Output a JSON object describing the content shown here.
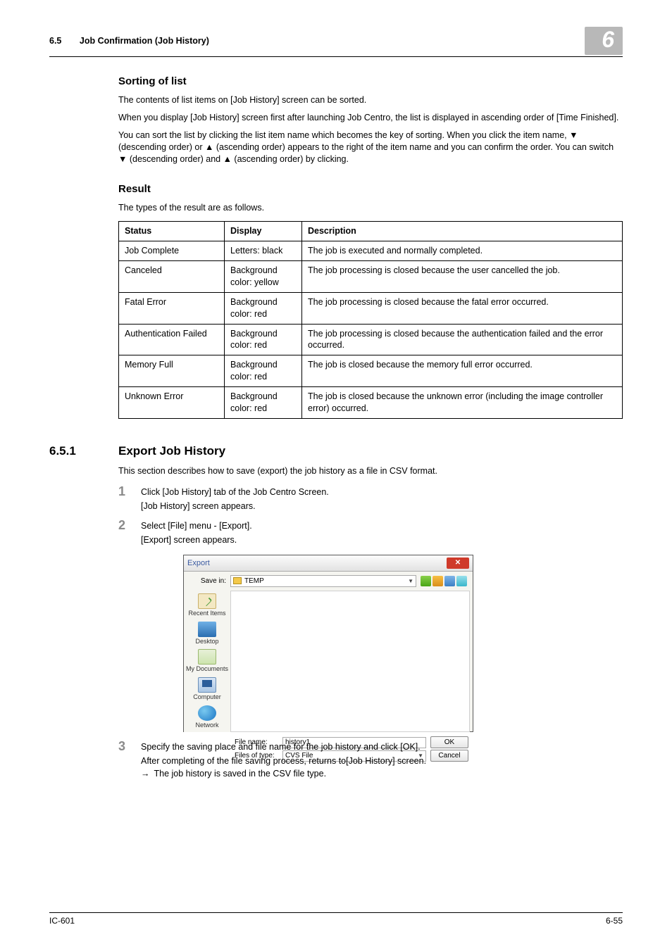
{
  "header": {
    "section_number": "6.5",
    "section_title": "Job Confirmation (Job History)",
    "chapter_badge": "6"
  },
  "sorting": {
    "heading": "Sorting of list",
    "p1": "The contents of list items on [Job History] screen can be sorted.",
    "p2": "When you display [Job History] screen first after launching Job Centro, the list is displayed in ascending order of [Time Finished].",
    "p3": "You can sort the list by clicking the list item name which becomes the key of sorting. When you click the item name, ▼ (descending order) or ▲ (ascending order) appears to the right of the item name and you can confirm the order. You can switch ▼ (descending order) and ▲ (ascending order) by clicking."
  },
  "result": {
    "heading": "Result",
    "intro": "The types of the result are as follows.",
    "cols": {
      "status": "Status",
      "display": "Display",
      "description": "Description"
    },
    "rows": [
      {
        "status": "Job Complete",
        "display": "Letters: black",
        "description": "The job is executed and normally completed."
      },
      {
        "status": "Canceled",
        "display": "Background color: yellow",
        "description": "The job processing is closed because the user cancelled the job."
      },
      {
        "status": "Fatal Error",
        "display": "Background color: red",
        "description": "The job processing is closed because the fatal error occurred."
      },
      {
        "status": "Authentication Failed",
        "display": "Background color: red",
        "description": "The job processing is closed because the authentication failed and the error occurred."
      },
      {
        "status": "Memory Full",
        "display": "Background color: red",
        "description": "The job is closed because the memory full error occurred."
      },
      {
        "status": "Unknown Error",
        "display": "Background color: red",
        "description": "The job is closed because the unknown error (including the image controller error) occurred."
      }
    ]
  },
  "export": {
    "section_number": "6.5.1",
    "section_title": "Export Job History",
    "intro": "This section describes how to save (export) the job history as a file in CSV format.",
    "steps": {
      "s1a": "Click [Job History] tab of the Job Centro Screen.",
      "s1b": "[Job History] screen appears.",
      "s2a": "Select [File] menu - [Export].",
      "s2b": "[Export] screen appears.",
      "s3a": "Specify the saving place and file name for the job history and click [OK].",
      "s3b": "After completing of the file saving process, returns to[Job History] screen.",
      "s3c": "The job history is saved in the CSV file type."
    }
  },
  "dialog": {
    "title": "Export",
    "save_in_label": "Save in:",
    "save_in_value": "TEMP",
    "sidebar": {
      "recent": "Recent Items",
      "desktop": "Desktop",
      "docs": "My Documents",
      "computer": "Computer",
      "network": "Network"
    },
    "file_name_label": "File name:",
    "file_name_value": "history1",
    "file_type_label": "Files of type:",
    "file_type_value": "CVS File",
    "ok": "OK",
    "cancel": "Cancel"
  },
  "footer": {
    "left": "IC-601",
    "right": "6-55"
  }
}
